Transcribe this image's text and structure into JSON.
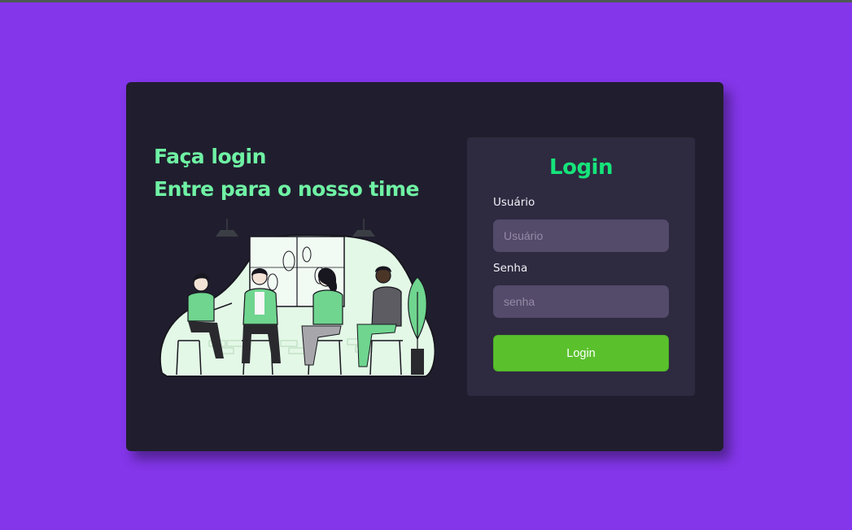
{
  "hero": {
    "line1": "Faça login",
    "line2": "Entre para o nosso time"
  },
  "login": {
    "title": "Login",
    "username_label": "Usuário",
    "username_placeholder": "Usuário",
    "username_value": "",
    "password_label": "Senha",
    "password_placeholder": "senha",
    "password_value": "",
    "button_label": "Login"
  },
  "colors": {
    "page_background": "#8436ea",
    "card_background": "#201e2e",
    "panel_background": "#2e2a40",
    "headline": "#6ff2a4",
    "title": "#16e47a",
    "input_background": "#544a6a",
    "button": "#5ac12c"
  },
  "illustration": {
    "icon": "team-meeting-illustration"
  }
}
